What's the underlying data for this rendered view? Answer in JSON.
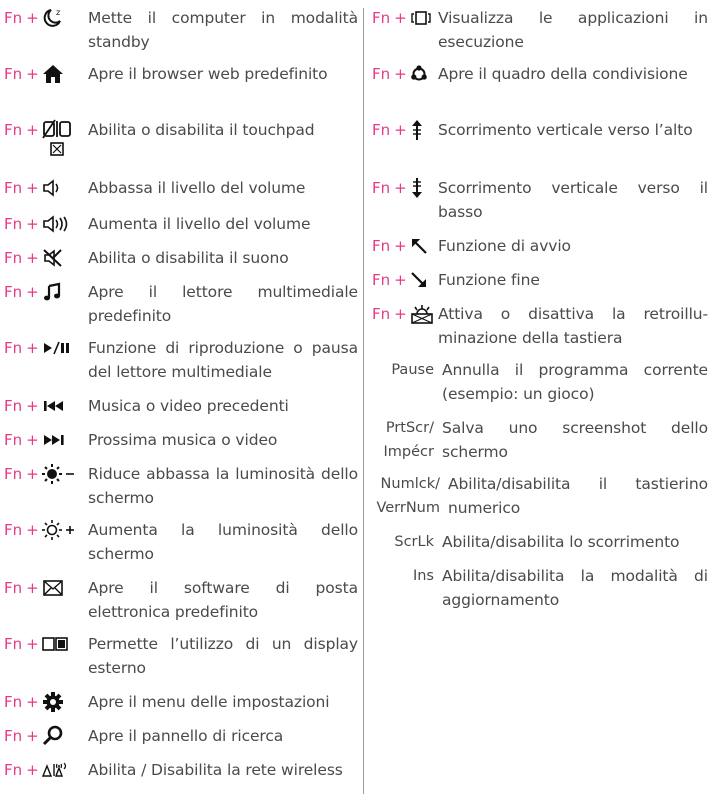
{
  "fn_label": "Fn",
  "plus_label": "+",
  "left": [
    {
      "icon": "sleep-moon-icon",
      "desc": "Mette il computer in modalità standby"
    },
    {
      "icon": "home-icon",
      "desc": "Apre il browser web predefinito"
    },
    {
      "icon": "touchpad-toggle-icon",
      "desc": "Abilita o disabilita il touchpad"
    },
    {
      "icon": "volume-down-icon",
      "desc": "Abbassa il livello del volume"
    },
    {
      "icon": "volume-up-icon",
      "desc": "Aumenta il livello del volume"
    },
    {
      "icon": "mute-icon",
      "desc": "Abilita o disabilita il suono"
    },
    {
      "icon": "music-note-icon",
      "desc": "Apre il lettore multimediale predefinito"
    },
    {
      "icon": "play-pause-icon",
      "desc": "Funzione di riproduzione o pausa del lettore multimediale"
    },
    {
      "icon": "previous-track-icon",
      "desc": "Musica o video precedenti"
    },
    {
      "icon": "next-track-icon",
      "desc": "Prossima musica o video"
    },
    {
      "icon": "brightness-down-icon",
      "desc": "Riduce abbassa la luminosità dello schermo"
    },
    {
      "icon": "brightness-up-icon",
      "desc": "Aumenta la luminosità dello schermo"
    },
    {
      "icon": "mail-icon",
      "desc": "Apre il software di posta elettronica predefinito"
    },
    {
      "icon": "external-display-icon",
      "desc": "Permette l’utilizzo di un display esterno"
    },
    {
      "icon": "settings-gear-icon",
      "desc": "Apre il menu delle impostazioni"
    },
    {
      "icon": "search-icon",
      "desc": "Apre il pannello di ricerca"
    },
    {
      "icon": "wireless-icon",
      "desc": "Abilita / Disabilita la rete wireless"
    }
  ],
  "right": [
    {
      "icon": "task-view-icon",
      "desc": "Visualizza le applicazioni in esecuzione"
    },
    {
      "icon": "share-icon",
      "desc": "Apre il quadro della condivisione"
    },
    {
      "icon": "scroll-up-icon",
      "desc": "Scorrimento verticale verso l’alto"
    },
    {
      "icon": "scroll-down-icon",
      "desc": "Scorrimento verticale verso il basso"
    },
    {
      "icon": "home-arrow-icon",
      "desc": "Funzione di avvio"
    },
    {
      "icon": "end-arrow-icon",
      "desc": "Funzione fine"
    },
    {
      "icon": "keyboard-backlight-icon",
      "desc": "Attiva o disattiva la retroillu-minazione della tastiera"
    },
    {
      "key": "Pause",
      "desc": "Annulla il programma corrente (esempio: un gioco)"
    },
    {
      "key": "PrtScr/ Impécr",
      "desc": "Salva uno screenshot dello schermo"
    },
    {
      "key": "Numlck/ VerrNum",
      "desc": "Abilita/disabilita il tastierino numerico"
    },
    {
      "key": "ScrLk",
      "desc": "Abilita/disabilita lo scorrimento"
    },
    {
      "key": "Ins",
      "desc": "Abilita/disabilita la modalità di aggiornamento"
    }
  ]
}
